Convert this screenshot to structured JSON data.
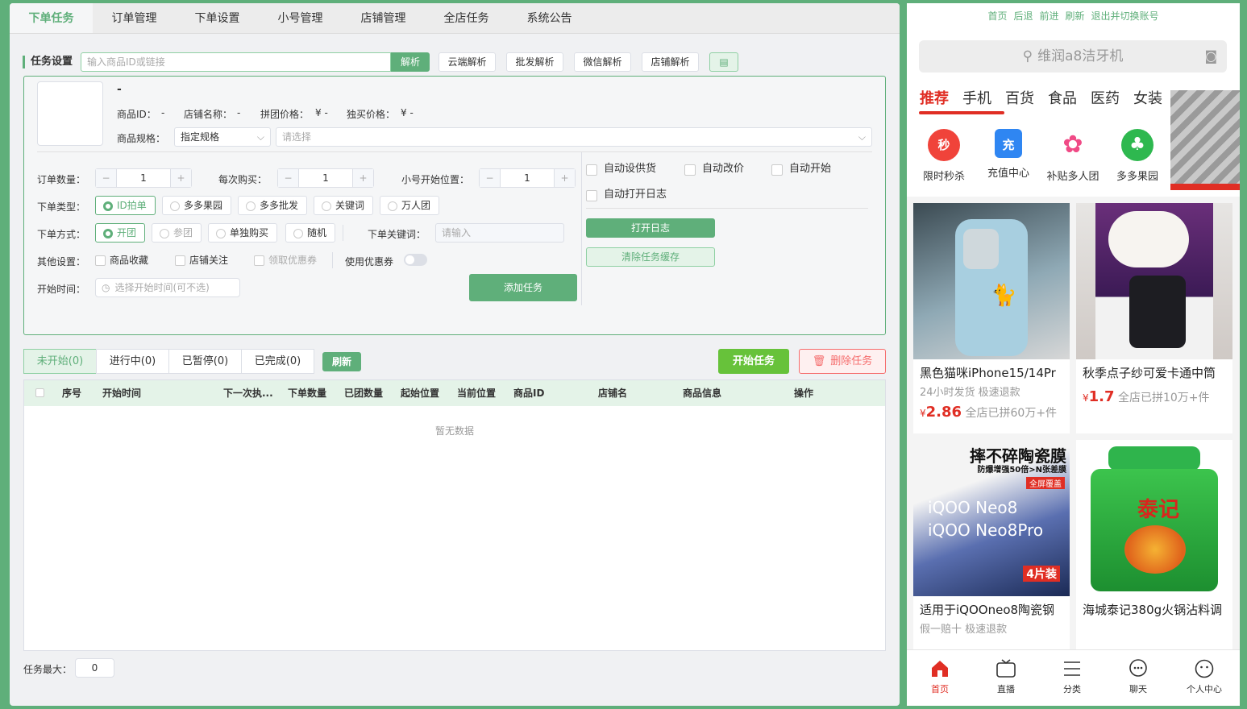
{
  "tabs": [
    "下单任务",
    "订单管理",
    "下单设置",
    "小号管理",
    "店铺管理",
    "全店任务",
    "系统公告"
  ],
  "task_settings": {
    "title": "任务设置",
    "input_placeholder": "输入商品ID或链接",
    "parse_button": "解析",
    "buttons": [
      "云端解析",
      "批发解析",
      "微信解析",
      "店铺解析"
    ]
  },
  "product": {
    "name": "-",
    "id_label": "商品ID：",
    "id_value": "-",
    "shop_label": "店铺名称：",
    "shop_value": "-",
    "group_price_label": "拼团价格：",
    "group_price_value": "¥ -",
    "single_price_label": "独买价格：",
    "single_price_value": "¥ -",
    "spec_label": "商品规格：",
    "spec_value": "指定规格",
    "spec_placeholder": "请选择"
  },
  "form": {
    "order_qty_label": "订单数量：",
    "order_qty": "1",
    "each_buy_label": "每次购买：",
    "each_buy": "1",
    "start_pos_label": "小号开始位置：",
    "start_pos": "1",
    "order_type_label": "下单类型：",
    "order_types": [
      "ID拍单",
      "多多果园",
      "多多批发",
      "关键词",
      "万人团"
    ],
    "order_mode_label": "下单方式：",
    "order_modes": [
      "开团",
      "参团",
      "单独购买",
      "随机"
    ],
    "keyword_label": "下单关键词：",
    "keyword_placeholder": "请输入",
    "other_label": "其他设置：",
    "others": [
      "商品收藏",
      "店铺关注",
      "领取优惠券",
      "使用优惠券"
    ],
    "start_time_label": "开始时间：",
    "start_time_placeholder": "选择开始时间(可不选)",
    "add_button": "添加任务"
  },
  "auto": {
    "options": [
      "自动设供货",
      "自动改价",
      "自动开始",
      "自动打开日志"
    ],
    "open_log": "打开日志",
    "clear_cache": "清除任务缓存"
  },
  "status_tabs": [
    "未开始(0)",
    "进行中(0)",
    "已暂停(0)",
    "已完成(0)"
  ],
  "refresh": "刷新",
  "start_task": "开始任务",
  "delete_task": "删除任务",
  "table": {
    "headers": [
      "序号",
      "开始时间",
      "下一次执...",
      "下单数量",
      "已团数量",
      "起始位置",
      "当前位置",
      "商品ID",
      "店铺名",
      "商品信息",
      "操作"
    ],
    "empty": "暂无数据"
  },
  "task_max_label": "任务最大：",
  "task_max": "0",
  "phone": {
    "nav": [
      "首页",
      "后退",
      "前进",
      "刷新",
      "退出并切换账号"
    ],
    "search": "维润a8洁牙机",
    "categories": [
      "推荐",
      "手机",
      "百货",
      "食品",
      "医药",
      "女装"
    ],
    "icons": [
      {
        "label": "限时秒杀",
        "glyph": "秒",
        "color": "#f0433a"
      },
      {
        "label": "充值中心",
        "glyph": "充",
        "color": "#2f86f2"
      },
      {
        "label": "补贴多人团",
        "glyph": "✿",
        "color": "#f04a86"
      },
      {
        "label": "多多果园",
        "glyph": "♣",
        "color": "#2eb84f"
      }
    ],
    "goods": [
      {
        "title": "黑色猫咪iPhone15/14Pr",
        "sub": "24小时发货  极速退款",
        "price": "2.86",
        "sold": "全店已拼60万+件"
      },
      {
        "title": "秋季点子纱可爱卡通中筒",
        "sub": "",
        "price": "1.7",
        "sold": "全店已拼10万+件"
      },
      {
        "title": "适用于iQOOneo8陶瓷钢",
        "sub": "假一赔十  极速退款",
        "price": "",
        "sold": ""
      },
      {
        "title": "海城泰记380g火锅沾料调",
        "sub": "",
        "price": "",
        "sold": ""
      }
    ],
    "promo": {
      "title": "摔不碎陶瓷膜",
      "line1": "防爆增强50倍>N张差膜",
      "line2": "全屏覆盖",
      "model1": "iQOO Neo8",
      "model2": "iQOO Neo8Pro",
      "pack": "4片装"
    },
    "jar": {
      "brand": "泰记"
    },
    "bottom": [
      "首页",
      "直播",
      "分类",
      "聊天",
      "个人中心"
    ]
  }
}
